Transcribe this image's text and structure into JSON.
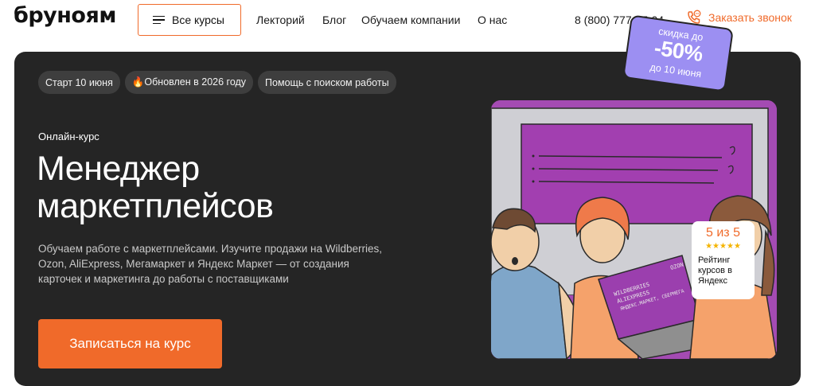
{
  "header": {
    "logo": "бруноям",
    "courses_button": "Все курсы",
    "nav": [
      "Лекторий",
      "Блог",
      "Обучаем компании",
      "О нас"
    ],
    "phone": "8 (800) 777-97-04",
    "callback": "Заказать звонок"
  },
  "hero": {
    "chips": [
      "Старт 10 июня",
      "🔥Обновлен в 2026 году",
      "Помощь с поиском работы"
    ],
    "eyebrow": "Онлайн-курс",
    "title_line1": "Менеджер",
    "title_line2": "маркетплейсов",
    "description": "Обучаем работе с маркетплейсами. Изучите продажи на Wildberries, Ozon, AliExpress, Мегамаркет и Яндекс Маркет — от создания карточек и маркетинга до работы с поставщиками",
    "cta": "Записаться на курс"
  },
  "discount": {
    "line1": "скидка до",
    "line2": "-50%",
    "line3": "до 10 июня"
  },
  "rating": {
    "score": "5 из 5",
    "stars": "★★★★★",
    "text": "Рейтинг курсов в Яндекс"
  },
  "illustration": {
    "laptop_text_1": "WILDBERRIES",
    "laptop_text_2": "ALIEXPRESS",
    "laptop_text_3": "ЯНДЕКС.МАРКЕТ, СБЕРМЕГА",
    "laptop_text_4": "OZON"
  },
  "colors": {
    "accent": "#f06a2a",
    "hero_bg": "#252525",
    "chip_bg": "#3e3e3e",
    "illustration_bg": "#a44bb3",
    "ticket": "#9c8ff2"
  }
}
